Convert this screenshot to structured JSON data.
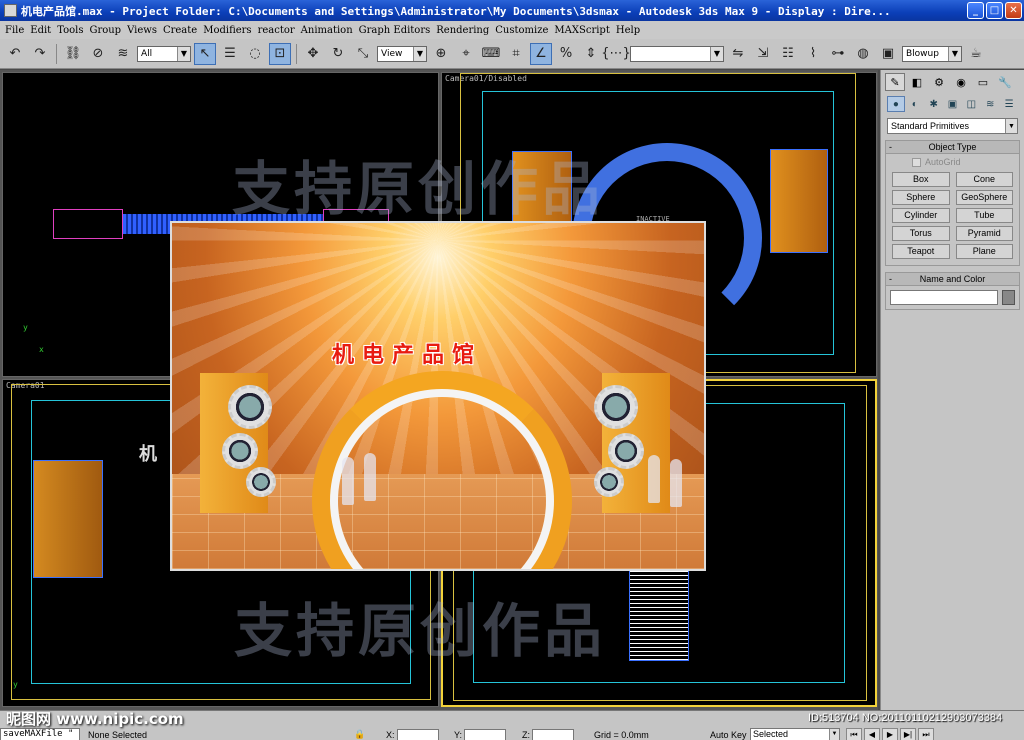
{
  "window": {
    "title": "机电产品馆.max    - Project Folder: C:\\Documents and Settings\\Administrator\\My Documents\\3dsmax    - Autodesk 3ds Max 9    - Display : Dire...",
    "minimize": "_",
    "maximize": "□",
    "close": "✕"
  },
  "menu": [
    "File",
    "Edit",
    "Tools",
    "Group",
    "Views",
    "Create",
    "Modifiers",
    "reactor",
    "Animation",
    "Graph Editors",
    "Rendering",
    "Customize",
    "MAXScript",
    "Help"
  ],
  "toolbar": {
    "selection_filter": "All",
    "reference_coord": "View",
    "named_selection": "",
    "render_type": "Blowup",
    "icons": {
      "undo": "↶",
      "redo": "↷",
      "link": "⛓",
      "unlink": "⊘",
      "bind": "≋",
      "select": "↖",
      "select_by_name": "☰",
      "region": "◌",
      "window_crossing": "⊡",
      "move": "✥",
      "rotate": "↻",
      "scale": "⤡",
      "pivot": "⊕",
      "manipulate": "⌖",
      "keyboard": "⌨",
      "snap": "⌗",
      "angle_snap": "∠",
      "percent_snap": "%",
      "spinner_snap": "⇕",
      "edit_named": "{⋯}",
      "mirror": "⇋",
      "align": "⇲",
      "layer": "☷",
      "curve_editor": "⌇",
      "schematic": "⊶",
      "material": "◍",
      "render_scene": "▣",
      "quick_render": "☕"
    }
  },
  "viewports": {
    "top_left": {
      "label": ""
    },
    "top_right": {
      "label": "Camera01/Disabled",
      "inactive_text": "INACTIVE"
    },
    "bottom_left": {
      "label": "Camera01"
    },
    "bottom_right": {
      "label": ""
    },
    "axis_y": "y",
    "axis_x": "x",
    "bl_title_fragment": "机"
  },
  "watermark": {
    "top": "支持原创作品",
    "bottom": "支持原创作品"
  },
  "render_preview": {
    "title": "机电产品馆"
  },
  "command_panel": {
    "category": "Standard Primitives",
    "object_type_title": "Object Type",
    "autogrid": "AutoGrid",
    "primitives": [
      "Box",
      "Cone",
      "Sphere",
      "GeoSphere",
      "Cylinder",
      "Tube",
      "Torus",
      "Pyramid",
      "Teapot",
      "Plane"
    ],
    "name_color_title": "Name and Color",
    "collapse_symbol": "-",
    "tabs": [
      "✎",
      "◧",
      "⚙",
      "◉",
      "▭",
      "🔧"
    ],
    "subtabs": [
      "●",
      "◐",
      "✱",
      "▣",
      "◫",
      "≋",
      "☰"
    ]
  },
  "status": {
    "maxscript": "saveMAXFile \"",
    "selection": "None Selected",
    "x_label": "X:",
    "y_label": "Y:",
    "z_label": "Z:",
    "grid": "Grid = 0.0mm",
    "auto_key": "Auto Key",
    "key_filter": "Selected",
    "playback": [
      "⏮",
      "◀",
      "▶",
      "▶|",
      "⏭"
    ]
  },
  "site": {
    "logo": "昵图网 www.nipic.com",
    "id": "ID:513704 NO:20110110212903073384"
  }
}
